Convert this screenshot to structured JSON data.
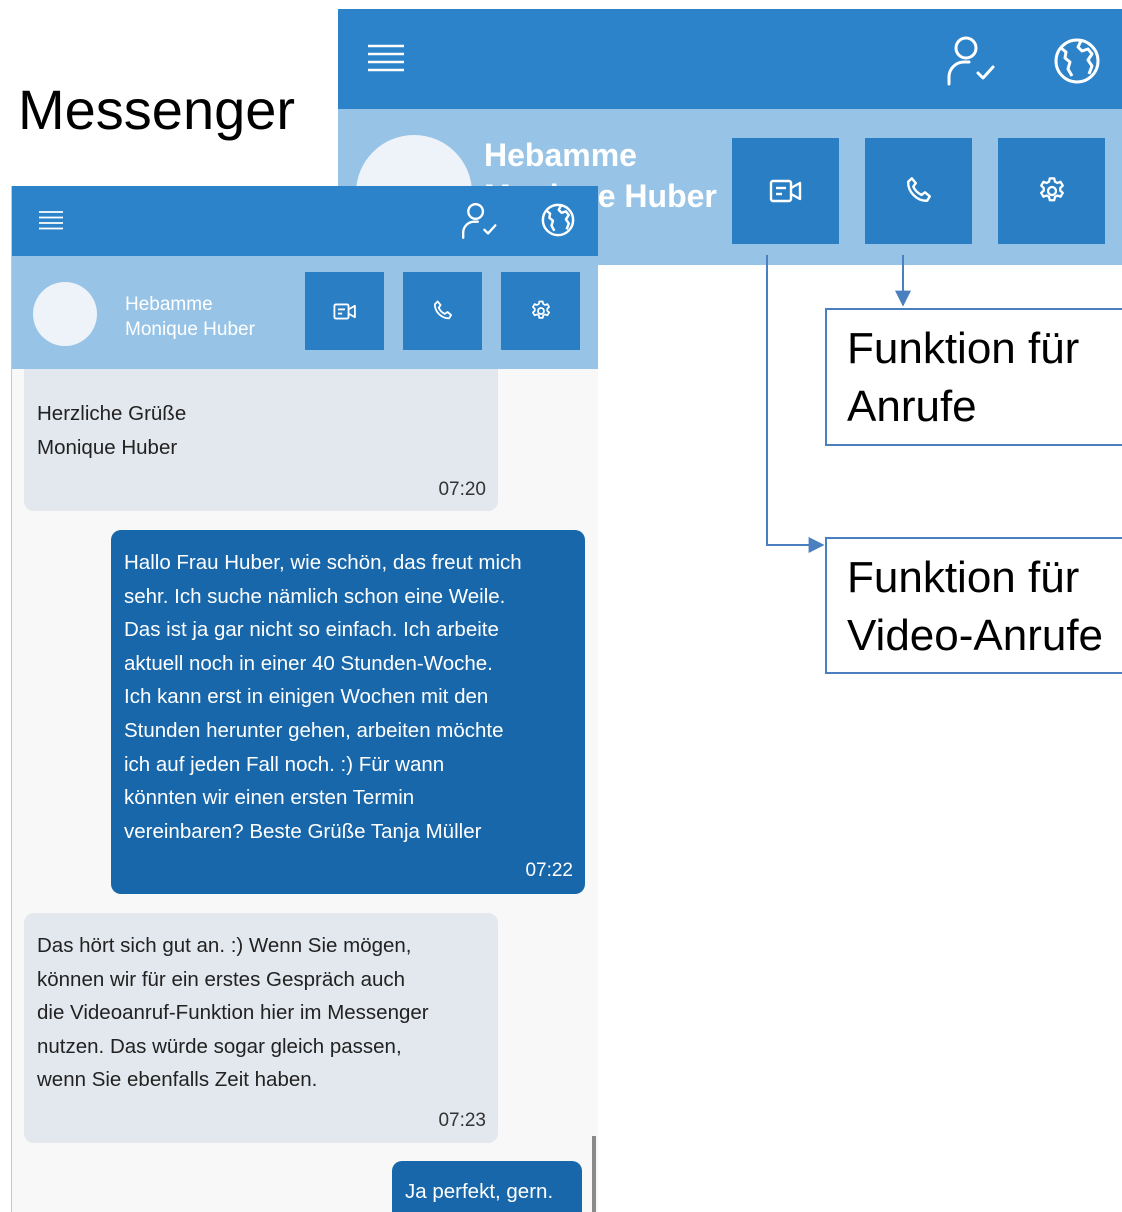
{
  "page": {
    "title": "Messenger"
  },
  "contact": {
    "role": "Hebamme",
    "name": "Monique Huber"
  },
  "icons": {
    "menu": "menu-icon",
    "profile": "user-check-icon",
    "language": "globe-icon",
    "video": "video-camera-icon",
    "call": "phone-icon",
    "settings": "gear-icon"
  },
  "colors": {
    "header": "#2c83c9",
    "subheader": "#97c4e6",
    "action_button": "#2a7fc4",
    "incoming_bubble": "#e3e8ee",
    "outgoing_bubble": "#1867aa",
    "callout_border": "#4a7fc0"
  },
  "messages": [
    {
      "direction": "incoming",
      "lines": [
        "Herzliche Grüße",
        "Monique Huber"
      ],
      "time": "07:20"
    },
    {
      "direction": "outgoing",
      "lines": [
        "Hallo Frau Huber, wie schön, das freut mich",
        "sehr. Ich suche nämlich schon eine Weile.",
        "Das ist ja gar nicht so einfach. Ich arbeite",
        "aktuell noch in einer 40 Stunden-Woche.",
        "Ich kann erst in einigen Wochen mit den",
        "Stunden herunter gehen, arbeiten möchte",
        "ich auf jeden Fall noch. :) Für wann",
        "könnten wir einen ersten Termin",
        "vereinbaren? Beste Grüße Tanja Müller"
      ],
      "time": "07:22"
    },
    {
      "direction": "incoming",
      "lines": [
        "Das hört sich gut an. :) Wenn Sie mögen,",
        "können wir für ein erstes Gespräch auch",
        "die Videoanruf-Funktion hier im Messenger",
        "nutzen. Das würde sogar gleich passen,",
        "wenn Sie ebenfalls Zeit haben."
      ],
      "time": "07:23"
    },
    {
      "direction": "outgoing",
      "lines": [
        "Ja perfekt, gern."
      ]
    }
  ],
  "callouts": {
    "calls": [
      "Funktion für",
      "Anrufe"
    ],
    "video_calls": [
      "Funktion für",
      "Video-Anrufe"
    ]
  }
}
